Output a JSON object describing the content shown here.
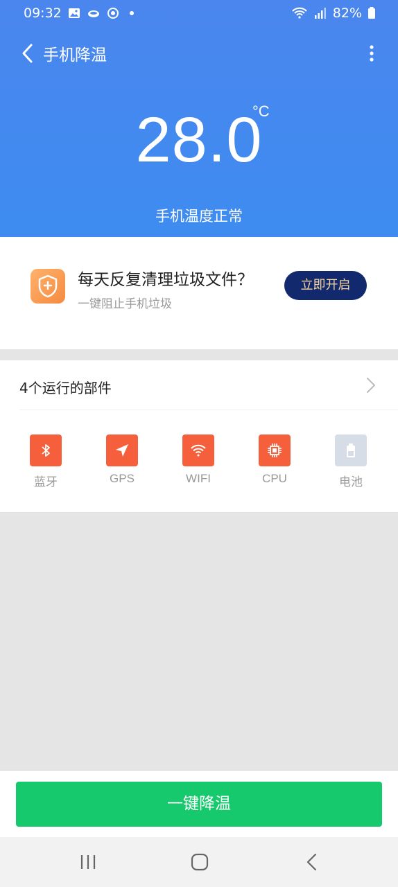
{
  "status_bar": {
    "time": "09:32",
    "battery": "82%",
    "icons": [
      "gallery-icon",
      "cloud-icon",
      "sync-icon",
      "wifi-icon",
      "signal-icon",
      "battery-icon"
    ]
  },
  "header": {
    "title": "手机降温",
    "temperature": "28.0",
    "unit": "°C",
    "status": "手机温度正常",
    "gradient_color": "#3e8cf0"
  },
  "promo": {
    "title": "每天反复清理垃圾文件？",
    "subtitle": "一键阻止手机垃圾",
    "button": "立即开启",
    "icon": "shield-clean-icon"
  },
  "parts": {
    "title": "4个运行的部件",
    "items": [
      {
        "label": "蓝牙",
        "icon": "bluetooth-icon",
        "active": true
      },
      {
        "label": "GPS",
        "icon": "gps-icon",
        "active": true
      },
      {
        "label": "WIFI",
        "icon": "wifi-icon",
        "active": true
      },
      {
        "label": "CPU",
        "icon": "cpu-icon",
        "active": true
      },
      {
        "label": "电池",
        "icon": "battery-icon",
        "active": false
      }
    ],
    "active_color": "#f65f3b"
  },
  "action": {
    "label": "一键降温",
    "color": "#16c96c"
  },
  "nav": {
    "icons": [
      "recent-apps-icon",
      "home-icon",
      "back-icon"
    ]
  }
}
